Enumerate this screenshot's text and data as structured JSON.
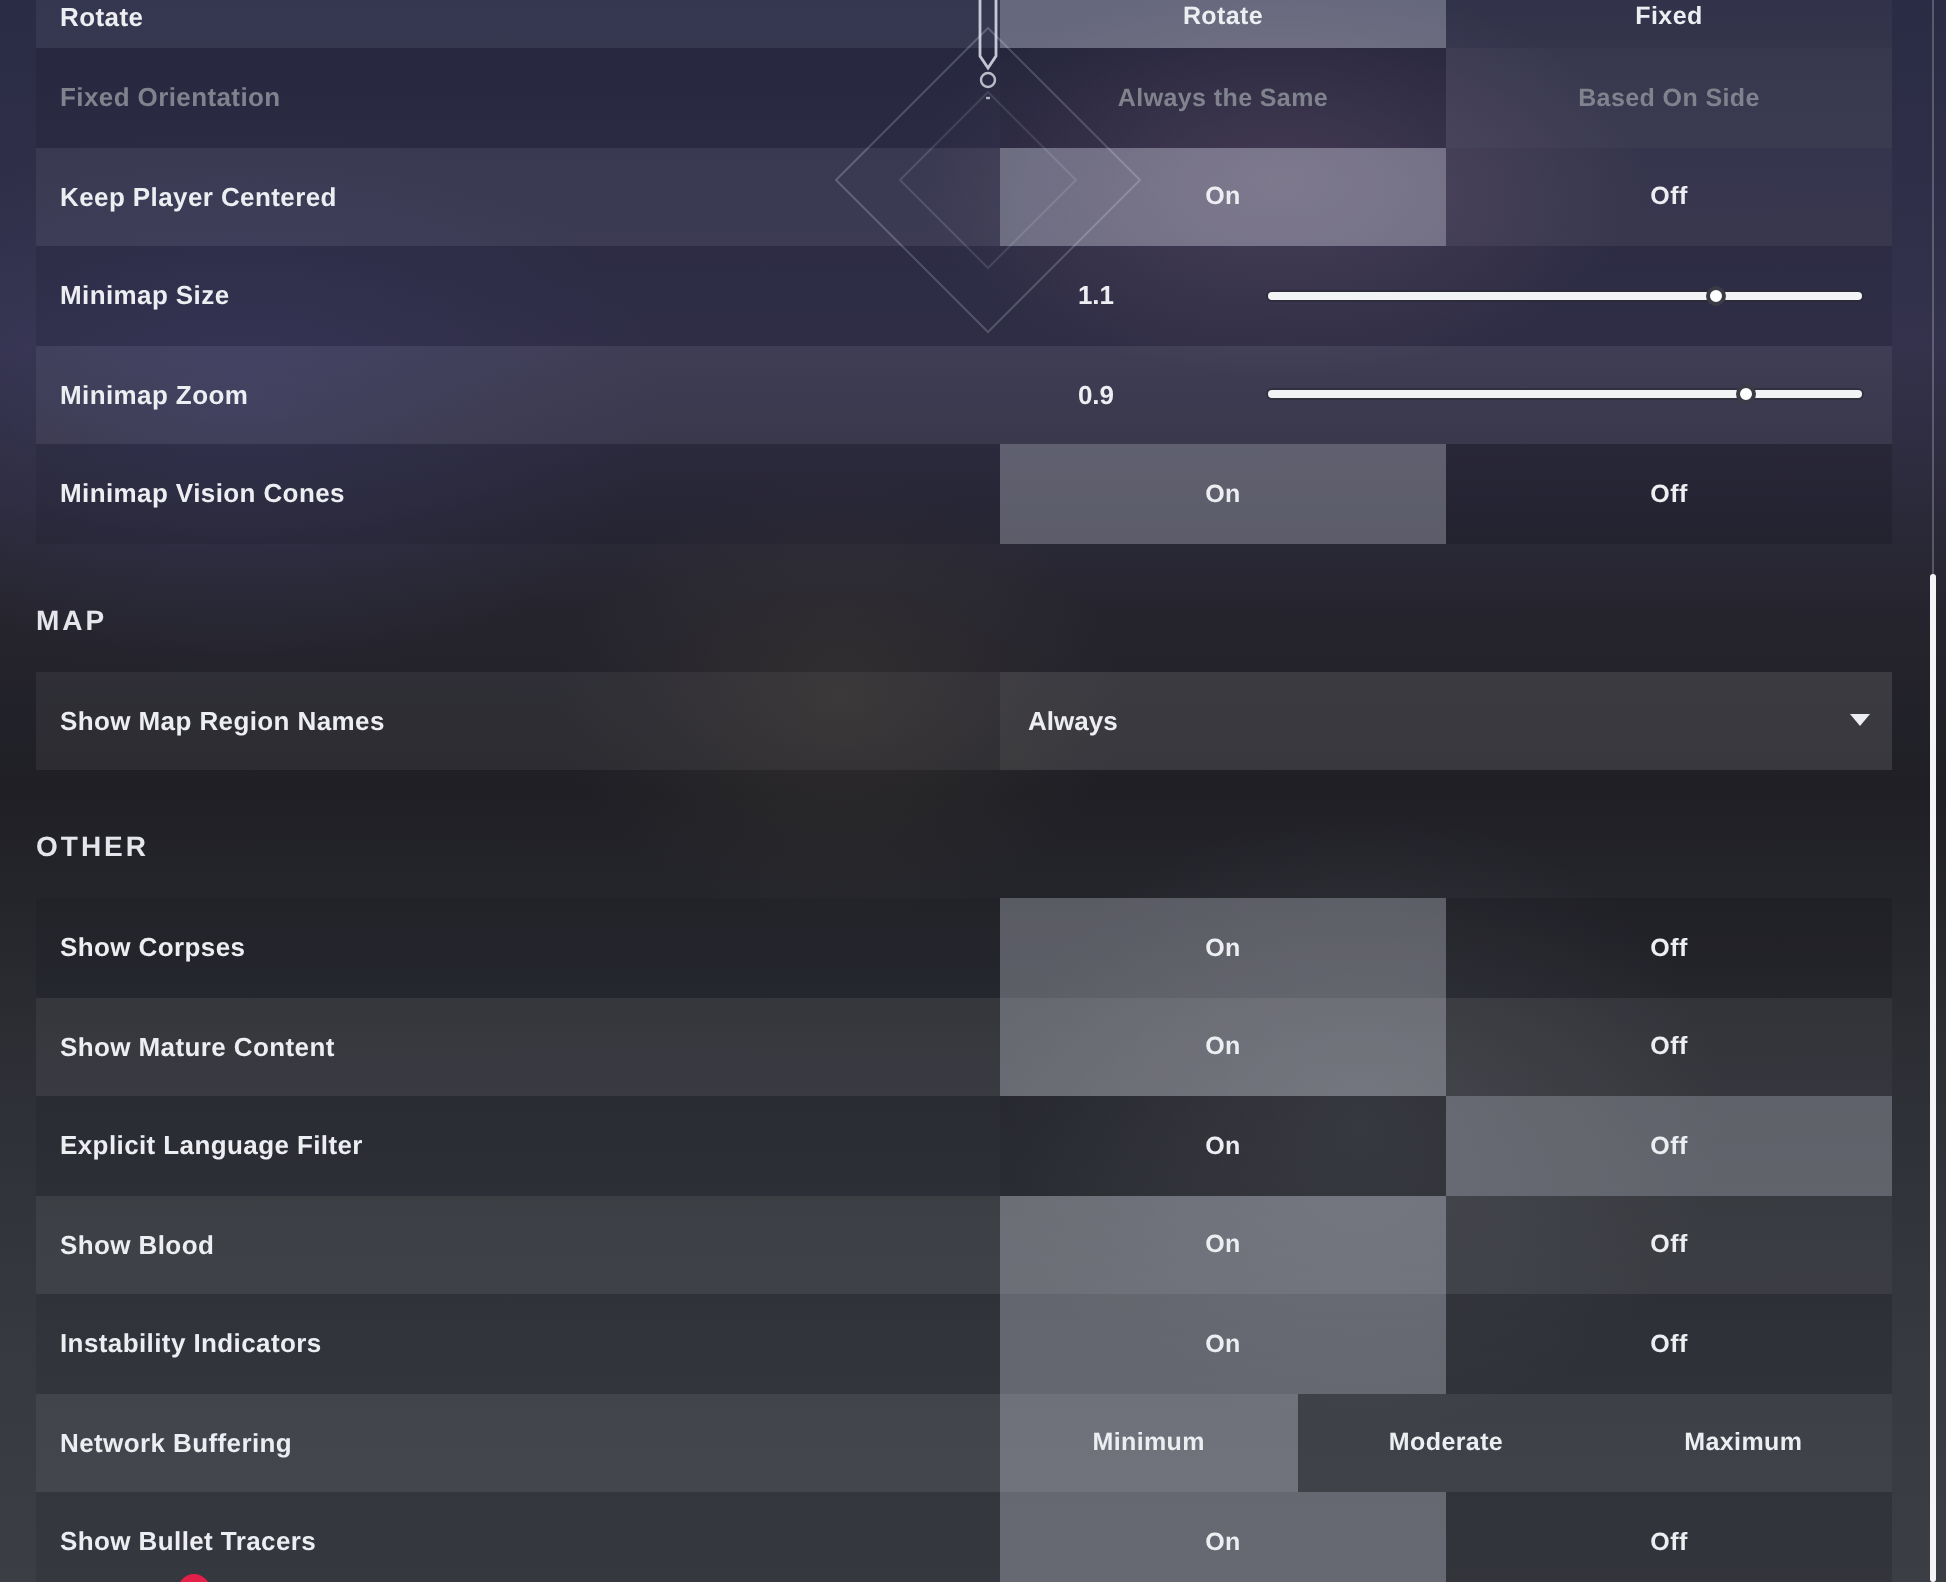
{
  "sections": [
    {
      "rows": [
        {
          "kind": "toggle",
          "label": "Rotate",
          "disabled": false,
          "options": [
            {
              "label": "Rotate",
              "selected": true
            },
            {
              "label": "Fixed",
              "selected": false
            }
          ]
        },
        {
          "kind": "toggle",
          "label": "Fixed Orientation",
          "disabled": true,
          "options": [
            {
              "label": "Always the Same",
              "selected": false
            },
            {
              "label": "Based On Side",
              "selected": true
            }
          ]
        },
        {
          "kind": "toggle",
          "label": "Keep Player Centered",
          "disabled": false,
          "options": [
            {
              "label": "On",
              "selected": true
            },
            {
              "label": "Off",
              "selected": false
            }
          ]
        },
        {
          "kind": "slider",
          "label": "Minimap Size",
          "disabled": false,
          "reading": "1.1",
          "level": 0.754
        },
        {
          "kind": "slider",
          "label": "Minimap Zoom",
          "disabled": false,
          "reading": "0.9",
          "level": 0.805
        },
        {
          "kind": "toggle",
          "label": "Minimap Vision Cones",
          "disabled": false,
          "options": [
            {
              "label": "On",
              "selected": true
            },
            {
              "label": "Off",
              "selected": false
            }
          ]
        }
      ]
    },
    {
      "title": "MAP",
      "rows": [
        {
          "kind": "dropdown",
          "label": "Show Map Region Names",
          "disabled": false,
          "value": "Always"
        }
      ]
    },
    {
      "title": "OTHER",
      "rows": [
        {
          "kind": "toggle",
          "label": "Show Corpses",
          "disabled": false,
          "options": [
            {
              "label": "On",
              "selected": true
            },
            {
              "label": "Off",
              "selected": false
            }
          ]
        },
        {
          "kind": "toggle",
          "label": "Show Mature Content",
          "disabled": false,
          "options": [
            {
              "label": "On",
              "selected": true
            },
            {
              "label": "Off",
              "selected": false
            }
          ]
        },
        {
          "kind": "toggle",
          "label": "Explicit Language Filter",
          "disabled": false,
          "options": [
            {
              "label": "On",
              "selected": false
            },
            {
              "label": "Off",
              "selected": true
            }
          ]
        },
        {
          "kind": "toggle",
          "label": "Show Blood",
          "disabled": false,
          "options": [
            {
              "label": "On",
              "selected": true
            },
            {
              "label": "Off",
              "selected": false
            }
          ]
        },
        {
          "kind": "toggle",
          "label": "Instability Indicators",
          "disabled": false,
          "options": [
            {
              "label": "On",
              "selected": true
            },
            {
              "label": "Off",
              "selected": false
            }
          ]
        },
        {
          "kind": "toggle",
          "label": "Network Buffering",
          "disabled": false,
          "options": [
            {
              "label": "Minimum",
              "selected": true
            },
            {
              "label": "Moderate",
              "selected": false
            },
            {
              "label": "Maximum",
              "selected": false
            }
          ]
        },
        {
          "kind": "toggle",
          "label": "Show Bullet Tracers",
          "disabled": false,
          "options": [
            {
              "label": "On",
              "selected": true
            },
            {
              "label": "Off",
              "selected": false
            }
          ]
        }
      ]
    }
  ]
}
